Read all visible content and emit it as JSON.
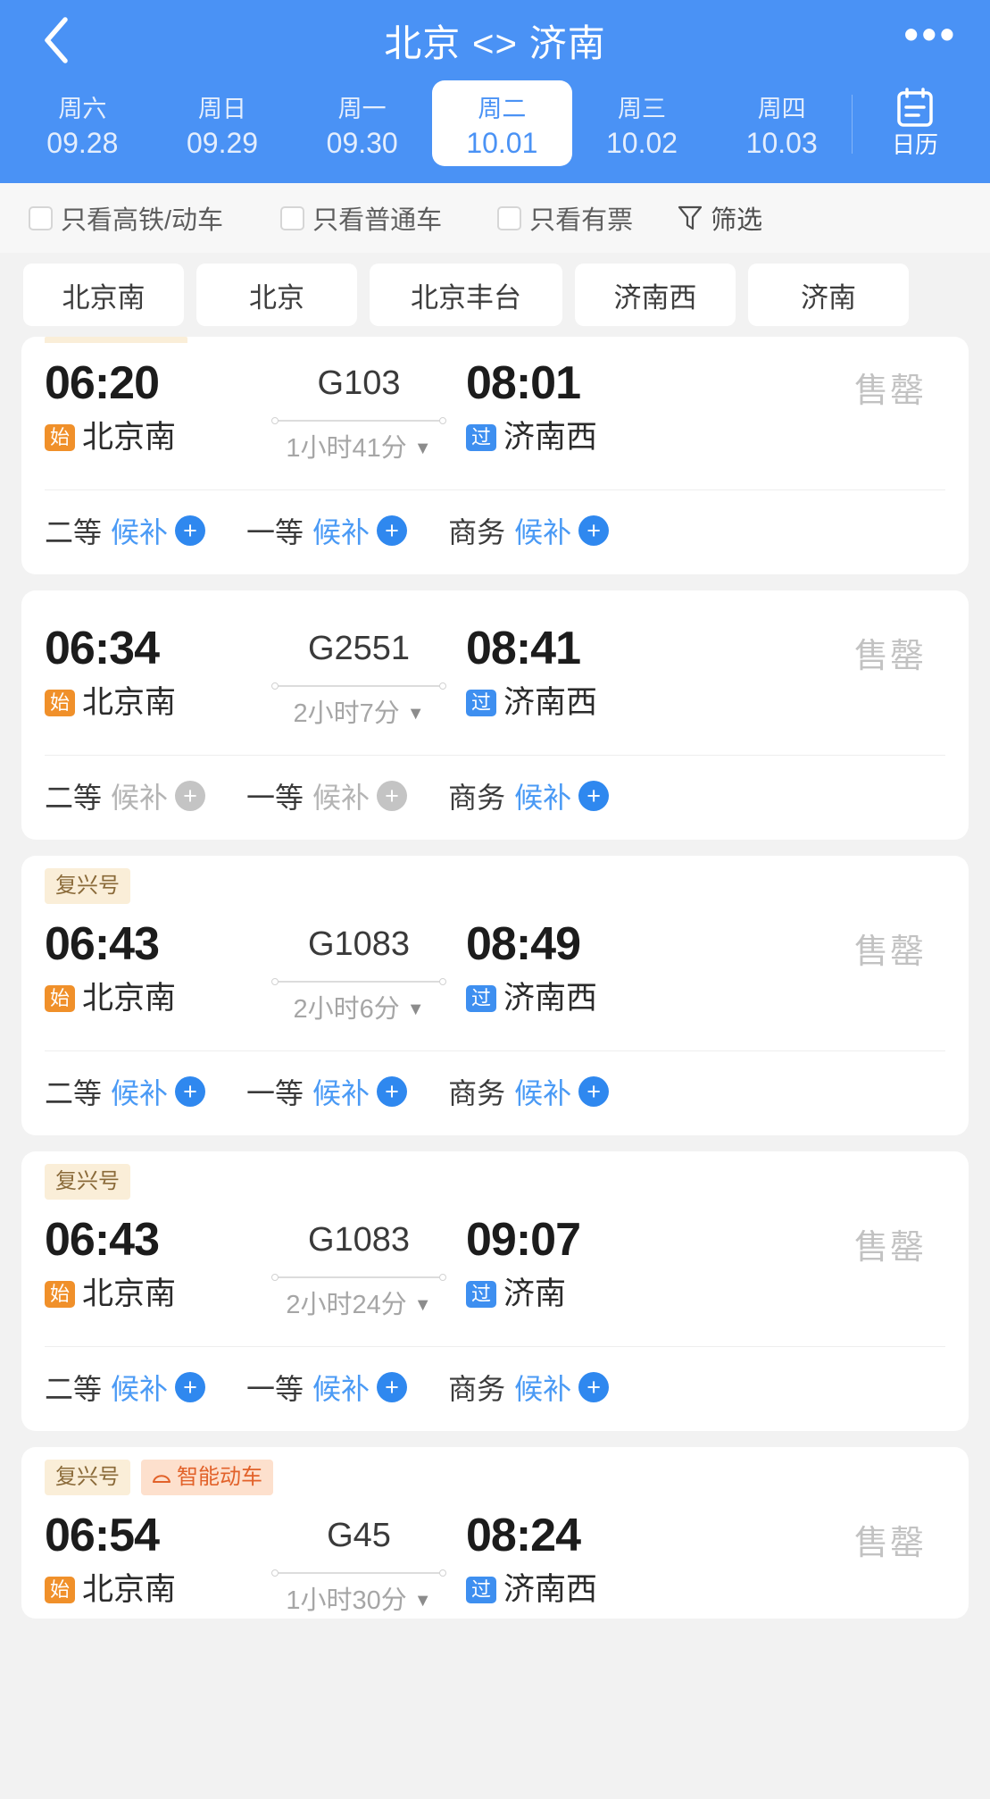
{
  "theme": {
    "primary": "#4a92f5",
    "start_badge": "#f0902a",
    "pass_badge": "#3e8ff0",
    "link": "#4a9af5",
    "disabled": "#b4b4b4"
  },
  "header": {
    "back_icon": "chevron-left-icon",
    "title": "北京 <> 济南",
    "more_icon": "more-horizontal-icon",
    "dates": [
      {
        "dow": "周六",
        "date": "09.28",
        "active": false
      },
      {
        "dow": "周日",
        "date": "09.29",
        "active": false
      },
      {
        "dow": "周一",
        "date": "09.30",
        "active": false
      },
      {
        "dow": "周二",
        "date": "10.01",
        "active": true
      },
      {
        "dow": "周三",
        "date": "10.02",
        "active": false
      },
      {
        "dow": "周四",
        "date": "10.03",
        "active": false
      }
    ],
    "calendar": {
      "icon": "calendar-icon",
      "label": "日历"
    }
  },
  "filters": {
    "items": [
      {
        "label": "只看高铁/动车",
        "checked": false
      },
      {
        "label": "只看普通车",
        "checked": false
      },
      {
        "label": "只看有票",
        "checked": false
      }
    ],
    "sort": {
      "icon": "funnel-icon",
      "label": "筛选"
    }
  },
  "stations": [
    {
      "label": "北京南"
    },
    {
      "label": "北京"
    },
    {
      "label": "北京丰台"
    },
    {
      "label": "济南西"
    },
    {
      "label": "济南"
    }
  ],
  "trains": [
    {
      "tags": [],
      "partial_tag_sliver": true,
      "depart_time": "06:20",
      "depart_badge": "始",
      "depart_station": "北京南",
      "train_no": "G103",
      "duration": "1小时41分",
      "arrive_time": "08:01",
      "arrive_badge": "过",
      "arrive_station": "济南西",
      "price_status": "售罄",
      "seats": [
        {
          "label": "二等",
          "status": "候补",
          "available": true
        },
        {
          "label": "一等",
          "status": "候补",
          "available": true
        },
        {
          "label": "商务",
          "status": "候补",
          "available": true
        }
      ]
    },
    {
      "tags": [],
      "partial_tag_sliver": false,
      "depart_time": "06:34",
      "depart_badge": "始",
      "depart_station": "北京南",
      "train_no": "G2551",
      "duration": "2小时7分",
      "arrive_time": "08:41",
      "arrive_badge": "过",
      "arrive_station": "济南西",
      "price_status": "售罄",
      "seats": [
        {
          "label": "二等",
          "status": "候补",
          "available": false
        },
        {
          "label": "一等",
          "status": "候补",
          "available": false
        },
        {
          "label": "商务",
          "status": "候补",
          "available": true
        }
      ]
    },
    {
      "tags": [
        {
          "label": "复兴号",
          "style": "fxh"
        }
      ],
      "partial_tag_sliver": false,
      "depart_time": "06:43",
      "depart_badge": "始",
      "depart_station": "北京南",
      "train_no": "G1083",
      "duration": "2小时6分",
      "arrive_time": "08:49",
      "arrive_badge": "过",
      "arrive_station": "济南西",
      "price_status": "售罄",
      "seats": [
        {
          "label": "二等",
          "status": "候补",
          "available": true
        },
        {
          "label": "一等",
          "status": "候补",
          "available": true
        },
        {
          "label": "商务",
          "status": "候补",
          "available": true
        }
      ]
    },
    {
      "tags": [
        {
          "label": "复兴号",
          "style": "fxh"
        }
      ],
      "partial_tag_sliver": false,
      "depart_time": "06:43",
      "depart_badge": "始",
      "depart_station": "北京南",
      "train_no": "G1083",
      "duration": "2小时24分",
      "arrive_time": "09:07",
      "arrive_badge": "过",
      "arrive_station": "济南",
      "price_status": "售罄",
      "seats": [
        {
          "label": "二等",
          "status": "候补",
          "available": true
        },
        {
          "label": "一等",
          "status": "候补",
          "available": true
        },
        {
          "label": "商务",
          "status": "候补",
          "available": true
        }
      ]
    },
    {
      "tags": [
        {
          "label": "复兴号",
          "style": "fxh"
        },
        {
          "label": "智能动车",
          "style": "znd",
          "icon": "smart-train-icon"
        }
      ],
      "partial_tag_sliver": false,
      "depart_time": "06:54",
      "depart_badge": "始",
      "depart_station": "北京南",
      "train_no": "G45",
      "duration": "1小时30分",
      "arrive_time": "08:24",
      "arrive_badge": "过",
      "arrive_station": "济南西",
      "price_status": "售罄",
      "seats": []
    }
  ]
}
